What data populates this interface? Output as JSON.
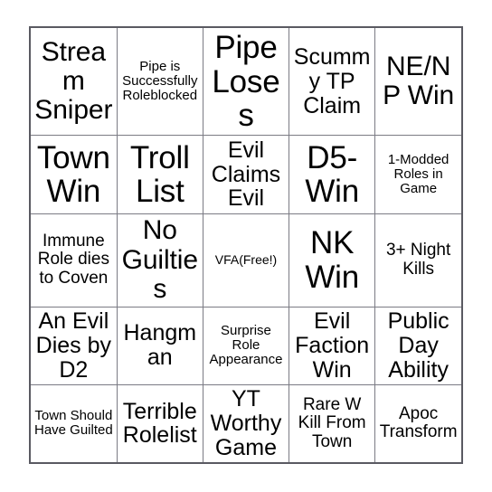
{
  "card": {
    "name": "bingo-card",
    "rows": 5,
    "columns": 5,
    "border_color": "#5a5a62",
    "grid_line_color": "#7b7b84",
    "background_color": "#ffffff",
    "text_color": "#000000",
    "free_space": "VFA(Free!)",
    "cells": [
      [
        {
          "text": "Stream Sniper",
          "size": "lg"
        },
        {
          "text": "Pipe is Successfully Roleblocked",
          "size": "xs"
        },
        {
          "text": "Pipe Loses",
          "size": "xl"
        },
        {
          "text": "Scummy TP Claim",
          "size": "md"
        },
        {
          "text": "NE/NP Win",
          "size": "lg"
        }
      ],
      [
        {
          "text": "Town Win",
          "size": "xl"
        },
        {
          "text": "Troll List",
          "size": "xl"
        },
        {
          "text": "Evil Claims Evil",
          "size": "md"
        },
        {
          "text": "D5-Win",
          "size": "xl"
        },
        {
          "text": "1-Modded Roles in Game",
          "size": "xs"
        }
      ],
      [
        {
          "text": "Immune Role dies to Coven",
          "size": "sm"
        },
        {
          "text": "No Guilties",
          "size": "lg"
        },
        {
          "text": "VFA(Free!)",
          "size": "xxs"
        },
        {
          "text": "NK Win",
          "size": "xl"
        },
        {
          "text": "3+ Night Kills",
          "size": "sm"
        }
      ],
      [
        {
          "text": "An Evil Dies by D2",
          "size": "md"
        },
        {
          "text": "Hangman",
          "size": "md"
        },
        {
          "text": "Surprise Role Appearance",
          "size": "xs"
        },
        {
          "text": "Evil Faction Win",
          "size": "md"
        },
        {
          "text": "Public Day Ability",
          "size": "md"
        }
      ],
      [
        {
          "text": "Town Should Have Guilted",
          "size": "xs"
        },
        {
          "text": "Terrible Rolelist",
          "size": "md"
        },
        {
          "text": "YT Worthy Game",
          "size": "md"
        },
        {
          "text": "Rare W Kill From Town",
          "size": "sm"
        },
        {
          "text": "Apoc Transform",
          "size": "sm"
        }
      ]
    ]
  }
}
